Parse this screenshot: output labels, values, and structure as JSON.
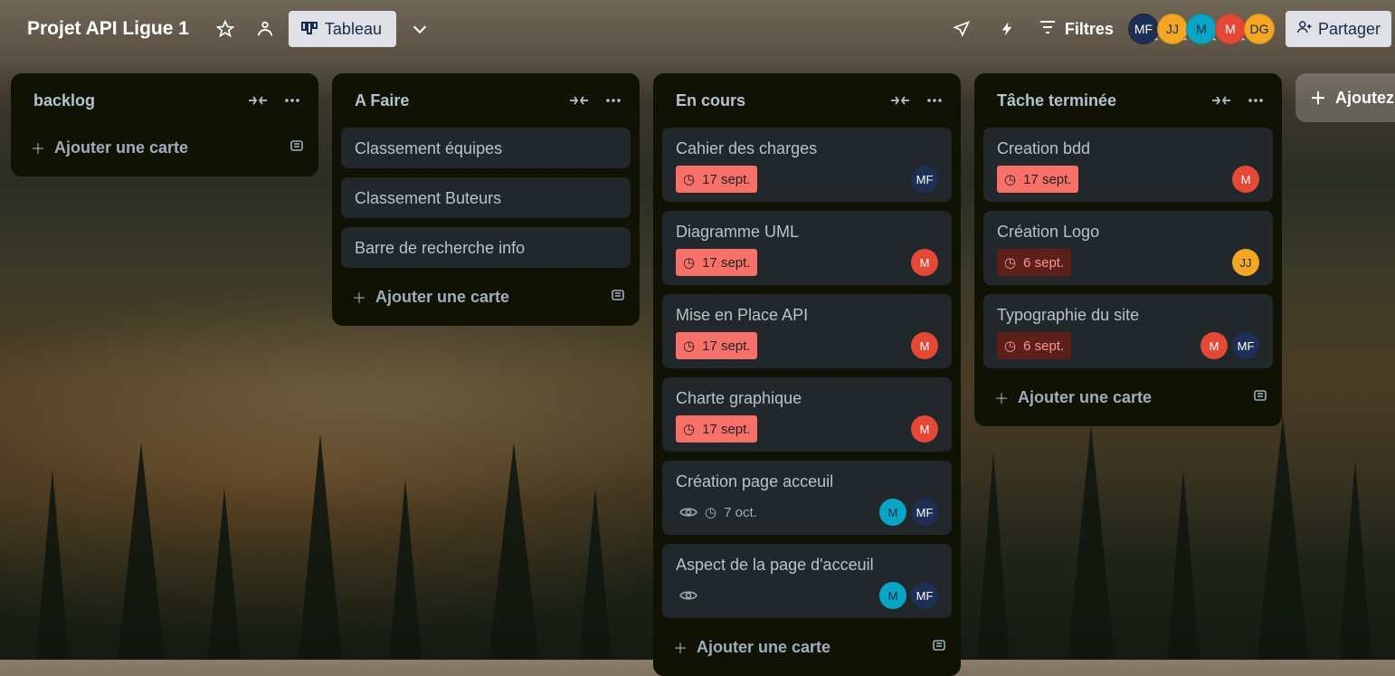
{
  "board": {
    "title": "Projet API Ligue 1"
  },
  "header": {
    "view_label": "Tableau",
    "filters_label": "Filtres",
    "share_label": "Partager",
    "avatars": [
      {
        "initials": "MF",
        "bg": "#1d2f55",
        "fg": "#ffffff"
      },
      {
        "initials": "JJ",
        "bg": "#f5a623",
        "fg": "#172b4d"
      },
      {
        "initials": "M",
        "bg": "#0aa5c4",
        "fg": "#172b4d"
      },
      {
        "initials": "M",
        "bg": "#e34935",
        "fg": "#ffffff"
      },
      {
        "initials": "DG",
        "bg": "#f5a623",
        "fg": "#172b4d"
      }
    ]
  },
  "add_card_label": "Ajouter une carte",
  "add_list_label": "Ajoutez",
  "lists": [
    {
      "title": "backlog"
    },
    {
      "title": "A Faire",
      "cards": [
        "Classement équipes",
        "Classement Buteurs",
        "Barre de recherche info"
      ]
    },
    {
      "title": "En cours",
      "cards": [
        {
          "title": "Cahier des charges",
          "due": "17 sept.",
          "members": [
            "MF"
          ]
        },
        {
          "title": "Diagramme UML",
          "due": "17 sept.",
          "members": [
            "M"
          ]
        },
        {
          "title": "Mise en Place API",
          "due": "17 sept.",
          "members": [
            "M"
          ]
        },
        {
          "title": "Charte graphique",
          "due": "17 sept.",
          "members": [
            "M"
          ]
        },
        {
          "title": "Création page acceuil",
          "due": "7 oct.",
          "members": [
            "M",
            "MF"
          ]
        },
        {
          "title": "Aspect de la page d'acceuil",
          "members": [
            "M",
            "MF"
          ]
        }
      ]
    },
    {
      "title": "Tâche terminée",
      "cards": [
        {
          "title": "Creation bdd",
          "due": "17 sept.",
          "members": [
            "M"
          ]
        },
        {
          "title": "Création Logo",
          "due": "6 sept.",
          "members": [
            "JJ"
          ]
        },
        {
          "title": "Typographie du site",
          "due": "6 sept.",
          "members": [
            "M",
            "MF"
          ]
        }
      ]
    }
  ],
  "colors": {
    "overdue_due": "#f87168",
    "past_due": "#5d1f1a",
    "avatar_mf": "#1d2f55",
    "avatar_m_red": "#e34935",
    "avatar_m_teal": "#0aa5c4",
    "avatar_jj": "#f5a623"
  }
}
